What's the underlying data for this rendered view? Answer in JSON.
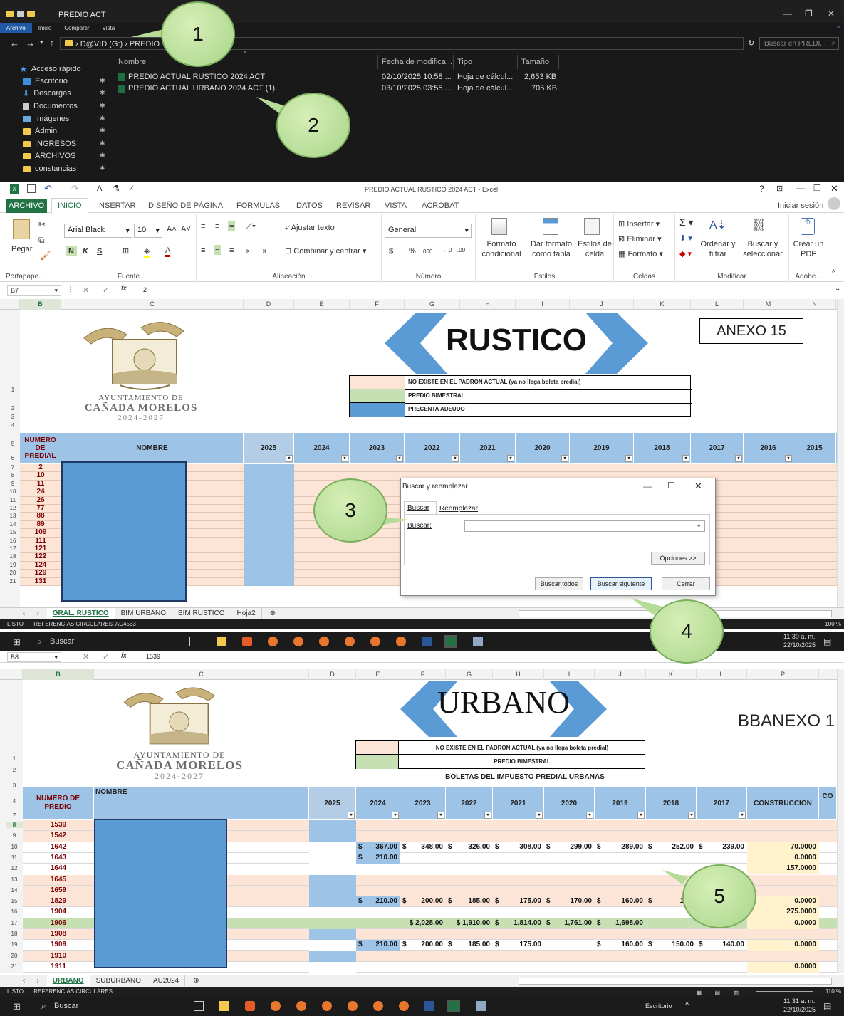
{
  "explorer": {
    "title": "PREDIO ACT",
    "tabs": [
      "Archivo",
      "Inicio",
      "Compartir",
      "Vista"
    ],
    "address": "› D@VID (G:) › PREDIO",
    "search_placeholder": "Buscar en PREDI...",
    "columns": {
      "name": "Nombre",
      "date": "Fecha de modifica...",
      "type": "Tipo",
      "size": "Tamaño"
    },
    "quick_access": "Acceso rápido",
    "nav": [
      "Escritorio",
      "Descargas",
      "Documentos",
      "Imágenes",
      "Admin",
      "INGRESOS",
      "ARCHIVOS",
      "constancias"
    ],
    "files": [
      {
        "name": "PREDIO ACTUAL RUSTICO 2024 ACT",
        "date": "02/10/2025 10:58 ...",
        "type": "Hoja de cálcul...",
        "size": "2,653 KB"
      },
      {
        "name": "PREDIO ACTUAL URBANO 2024 ACT (1)",
        "date": "03/10/2025 03:55 ...",
        "type": "Hoja de cálcul...",
        "size": "705 KB"
      }
    ]
  },
  "callouts": [
    "1",
    "2",
    "3",
    "4",
    "5"
  ],
  "excel1": {
    "window_title": "PREDIO ACTUAL RUSTICO 2024 ACT - Excel",
    "tabs": [
      "ARCHIVO",
      "INICIO",
      "INSERTAR",
      "DISEÑO DE PÁGINA",
      "FÓRMULAS",
      "DATOS",
      "REVISAR",
      "VISTA",
      "ACROBAT"
    ],
    "signin": "Iniciar sesión",
    "ribbon": {
      "paste": "Pegar",
      "clipboard": "Portapape...",
      "font_name": "Arial Black",
      "font_size": "10",
      "bold": "N",
      "italic": "K",
      "underline": "S",
      "font_group": "Fuente",
      "wrap": "Ajustar texto",
      "merge": "Combinar y centrar",
      "align_group": "Alineación",
      "number_format": "General",
      "currency": "$",
      "percent": "%",
      "thousands": "000",
      "number_group": "Número",
      "cond_format": "Formato condicional",
      "table_format": "Dar formato como tabla",
      "cell_styles": "Estilos de celda",
      "styles_group": "Estilos",
      "insert": "Insertar",
      "delete": "Eliminar",
      "format": "Formato",
      "cells_group": "Celdas",
      "sort": "Ordenar y filtrar",
      "find": "Buscar y seleccionar",
      "modify_group": "Modificar",
      "pdf": "Crear un PDF",
      "adobe_group": "Adobe..."
    },
    "namebox": "B7",
    "formula": "2",
    "columns": [
      "B",
      "C",
      "D",
      "E",
      "F",
      "G",
      "H",
      "I",
      "J",
      "K",
      "L",
      "M",
      "N"
    ],
    "logo_line1": "AYUNTAMIENTO DE",
    "logo_line2": "CAÑADA MORELOS",
    "logo_line3": "2024-2027",
    "banner": "RUSTICO",
    "anexo": "ANEXO 15",
    "legend": [
      "NO EXISTE EN EL PADRON ACTUAL (ya no llega boleta predial)",
      "PREDIO BIMESTRAL",
      "PRECENTA ADEUDO"
    ],
    "header_numero": "NUMERO DE PREDIAL",
    "header_nombre": "NOMBRE",
    "years": [
      "2025",
      "2024",
      "2023",
      "2022",
      "2021",
      "2020",
      "2019",
      "2018",
      "2017",
      "2016",
      "2015"
    ],
    "row_numbers": [
      "1",
      "2",
      "3",
      "4",
      "5",
      "6",
      "7",
      "8",
      "9",
      "10",
      "11",
      "12",
      "13",
      "14",
      "15",
      "16",
      "17",
      "18",
      "19",
      "20",
      "21"
    ],
    "predios": [
      "2",
      "10",
      "11",
      "24",
      "26",
      "77",
      "88",
      "89",
      "109",
      "111",
      "121",
      "122",
      "124",
      "129",
      "131"
    ],
    "sheet_tabs": [
      "GRAL. RUSTICO",
      "BIM URBANO",
      "BIM RUSTICO",
      "Hoja2"
    ],
    "status": "LISTO",
    "status2": "REFERENCIAS CIRCULARES: AC4533",
    "zoom": "100 %"
  },
  "dialog": {
    "title": "Buscar y reemplazar",
    "tab_find": "Buscar",
    "tab_replace": "Reemplazar",
    "find_label": "Buscar:",
    "find_value": "",
    "options": "Opciones >>",
    "find_all": "Buscar todos",
    "find_next": "Buscar siguiente",
    "close": "Cerrar"
  },
  "taskbar": {
    "search": "Buscar",
    "time1": "11:30 a. m.",
    "date1": "22/10/2025",
    "time2": "11:31 a. m.",
    "date2": "22/10/2025",
    "desktop": "Escritorio"
  },
  "excel2": {
    "namebox": "B8",
    "formula": "1539",
    "columns": [
      "B",
      "C",
      "D",
      "E",
      "F",
      "G",
      "H",
      "I",
      "J",
      "K",
      "L",
      "P"
    ],
    "banner": "URBANO",
    "anexo": "BBANEXO 1",
    "legend": [
      "NO EXISTE EN EL PADRON ACTUAL (ya no llega boleta predial)",
      "PREDIO BIMESTRAL"
    ],
    "subtitle": "BOLETAS DEL IMPUESTO PREDIAL URBANAS",
    "header_numero": "NUMERO DE PREDIO",
    "header_nombre": "NOMBRE",
    "years": [
      "2025",
      "2024",
      "2023",
      "2022",
      "2021",
      "2020",
      "2019",
      "2018",
      "2017"
    ],
    "construccion": "CONSTRUCCION",
    "co": "CO",
    "row_numbers": [
      "1",
      "2",
      "3",
      "4",
      "7",
      "8",
      "9",
      "10",
      "11",
      "12",
      "13",
      "14",
      "15",
      "16",
      "17",
      "18",
      "19",
      "20",
      "21"
    ],
    "rows": [
      {
        "predio": "1539",
        "vals": [
          "",
          "",
          "",
          "",
          "",
          "",
          "",
          "",
          ""
        ],
        "cons": ""
      },
      {
        "predio": "1542",
        "vals": [
          "",
          "",
          "",
          "",
          "",
          "",
          "",
          "",
          ""
        ],
        "cons": ""
      },
      {
        "predio": "1642",
        "vals": [
          "",
          "367.00",
          "348.00",
          "326.00",
          "308.00",
          "299.00",
          "289.00",
          "252.00",
          "239.00"
        ],
        "cons": "70.0000"
      },
      {
        "predio": "1643",
        "vals": [
          "",
          "210.00",
          "",
          "",
          "",
          "",
          "",
          "",
          ""
        ],
        "cons": "0.0000"
      },
      {
        "predio": "1644",
        "vals": [
          "",
          "",
          "",
          "",
          "",
          "",
          "",
          "",
          ""
        ],
        "cons": "157.0000"
      },
      {
        "predio": "1645",
        "vals": [
          "",
          "",
          "",
          "",
          "",
          "",
          "",
          "",
          ""
        ],
        "cons": ""
      },
      {
        "predio": "1659",
        "vals": [
          "",
          "",
          "",
          "",
          "",
          "",
          "",
          "",
          ""
        ],
        "cons": ""
      },
      {
        "predio": "1829",
        "vals": [
          "",
          "210.00",
          "200.00",
          "185.00",
          "175.00",
          "170.00",
          "160.00",
          "150.",
          ""
        ],
        "cons": "0.0000"
      },
      {
        "predio": "1904",
        "vals": [
          "",
          "",
          "",
          "",
          "",
          "",
          "",
          "",
          ""
        ],
        "cons": "275.0000"
      },
      {
        "predio": "1906",
        "vals": [
          "",
          "",
          "$ 2,028.00",
          "$ 1,910.00",
          "1,814.00",
          "1,761.00",
          "1,698.00",
          "",
          ""
        ],
        "cons": "0.0000"
      },
      {
        "predio": "1908",
        "vals": [
          "",
          "",
          "",
          "",
          "",
          "",
          "",
          "",
          ""
        ],
        "cons": ""
      },
      {
        "predio": "1909",
        "vals": [
          "",
          "210.00",
          "200.00",
          "185.00",
          "175.00",
          "",
          "160.00",
          "150.00",
          "140.00"
        ],
        "cons": "0.0000"
      },
      {
        "predio": "1910",
        "vals": [
          "",
          "",
          "",
          "",
          "",
          "",
          "",
          "",
          ""
        ],
        "cons": ""
      },
      {
        "predio": "1911",
        "vals": [
          "",
          "",
          "",
          "",
          "",
          "",
          "",
          "",
          ""
        ],
        "cons": "0.0000"
      }
    ],
    "sheet_tabs": [
      "URBANO",
      "SUBURBANO",
      "AU2024"
    ],
    "status": "LISTO",
    "status2": "REFERENCIAS CIRCULARES",
    "zoom": "110 %"
  },
  "colors": {
    "pink": "#fce4d6",
    "green": "#c6e0b4",
    "blue": "#5b9bd5",
    "header": "#9dc3e6",
    "excel_green": "#217346"
  }
}
